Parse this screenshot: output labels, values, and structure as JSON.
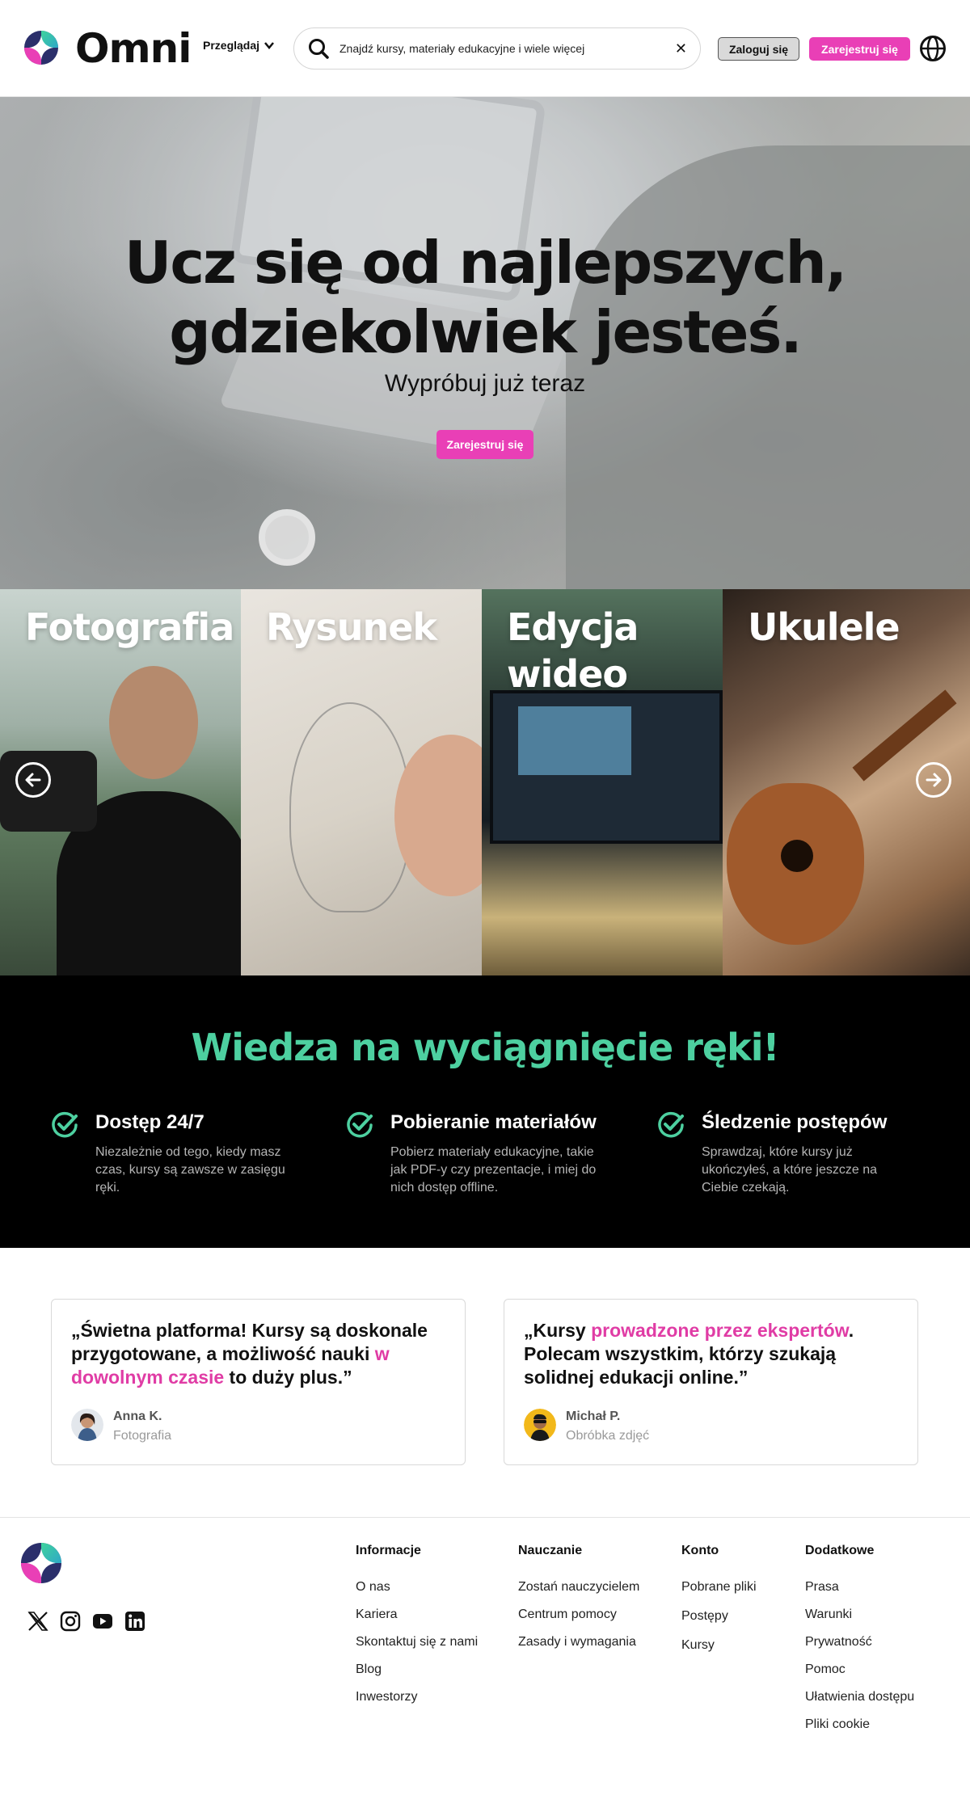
{
  "header": {
    "brand": "Omni",
    "browse_label": "Przeglądaj",
    "search_placeholder": "Znajdź kursy, materiały edukacyjne i wiele więcej",
    "login_label": "Zaloguj się",
    "signup_label": "Zarejestruj się"
  },
  "hero": {
    "title_line1": "Ucz się od najlepszych,",
    "title_line2": "gdziekolwiek jesteś.",
    "subtitle": "Wypróbuj już teraz",
    "cta_label": "Zarejestruj się"
  },
  "categories": [
    {
      "label": "Fotografia"
    },
    {
      "label": "Rysunek"
    },
    {
      "label": "Edycja wideo"
    },
    {
      "label": "Ukulele"
    }
  ],
  "features": {
    "title": "Wiedza na wyciągnięcie ręki!",
    "items": [
      {
        "title": "Dostęp 24/7",
        "desc": "Niezależnie od tego, kiedy masz czas, kursy są zawsze w zasięgu ręki."
      },
      {
        "title": "Pobieranie materiałów",
        "desc": "Pobierz materiały edukacyjne, takie jak PDF-y czy prezentacje, i miej do nich dostęp offline."
      },
      {
        "title": "Śledzenie postępów",
        "desc": "Sprawdzaj, które kursy już ukończyłeś, a które jeszcze na Ciebie czekają."
      }
    ]
  },
  "testimonials": [
    {
      "q1": "„Świetna platforma! Kursy są doskonale przygotowane, a możliwość nauki ",
      "q_hl": "w dowolnym czasie",
      "q2": " to duży plus.”",
      "name": "Anna K.",
      "role": "Fotografia"
    },
    {
      "q1": "„Kursy ",
      "q_hl": "prowadzone przez ekspertów",
      "q2": ". Polecam wszystkim, którzy szukają solidnej edukacji online.”",
      "name": "Michał P.",
      "role": "Obróbka zdjęć"
    }
  ],
  "footer": {
    "social_icons": [
      "x-icon",
      "instagram-icon",
      "youtube-icon",
      "linkedin-icon"
    ],
    "columns": [
      {
        "heading": "Informacje",
        "links": [
          "O nas",
          "Kariera",
          "Skontaktuj się z nami",
          "Blog",
          "Inwestorzy"
        ]
      },
      {
        "heading": "Nauczanie",
        "links": [
          "Zostań nauczycielem",
          "Centrum pomocy",
          "Zasady i wymagania"
        ]
      },
      {
        "heading": "Konto",
        "links": [
          "Pobrane pliki",
          "Postępy",
          "Kursy"
        ]
      },
      {
        "heading": "Dodatkowe",
        "links": [
          "Prasa",
          "Warunki",
          "Prywatność",
          "Pomoc",
          "Ułatwienia dostępu",
          "Pliki cookie"
        ]
      }
    ]
  },
  "colors": {
    "accent_pink": "#e93fb6",
    "accent_green": "#4dd0a0",
    "highlight_pink": "#e03ca5"
  }
}
